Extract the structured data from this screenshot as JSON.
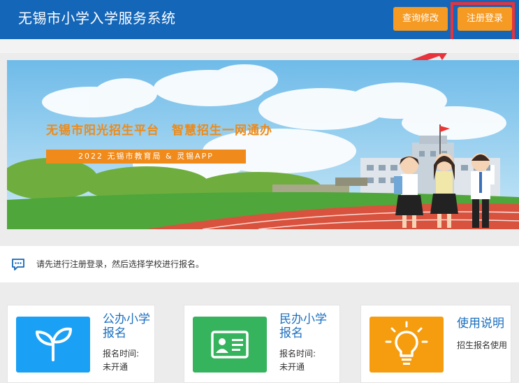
{
  "header": {
    "title": "无锡市小学入学服务系统",
    "query_button": "查询修改",
    "register_button": "注册登录"
  },
  "banner": {
    "headline": "无锡市阳光招生平台　智慧招生一网通办",
    "tagline": "2022  无锡市教育局 & 灵锡APP"
  },
  "notice": {
    "icon": "message-dots-icon",
    "text": "请先进行注册登录，然后选择学校进行报名。"
  },
  "cards": [
    {
      "title": "公办小学报名",
      "meta_label": "报名时间:",
      "meta_value": "未开通",
      "icon": "sprout-icon",
      "color": "#1aa1f5"
    },
    {
      "title": "民办小学报名",
      "meta_label": "报名时间:",
      "meta_value": "未开通",
      "icon": "id-card-icon",
      "color": "#36b35d"
    },
    {
      "title": "使用说明",
      "meta_label": "招生报名使用",
      "meta_value": "",
      "icon": "light-bulb-icon",
      "color": "#f59d0f"
    }
  ],
  "colors": {
    "header_bg": "#1466b8",
    "accent_orange": "#f59a23",
    "highlight_red": "#e8323c"
  }
}
